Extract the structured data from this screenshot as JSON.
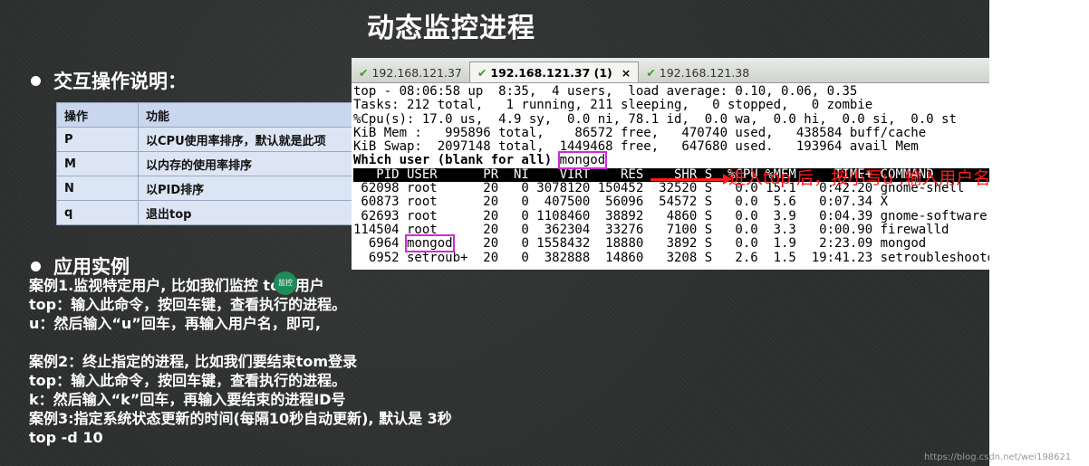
{
  "slide_title": "动态监控进程",
  "section1_title": "交互操作说明：",
  "table": {
    "headers": [
      "操作",
      "功能"
    ],
    "rows": [
      [
        "P",
        "以CPU使用率排序，默认就是此项"
      ],
      [
        "M",
        "以内存的使用率排序"
      ],
      [
        "N",
        "以PID排序"
      ],
      [
        "q",
        "退出top"
      ]
    ]
  },
  "section2_title": "应用实例",
  "cases": [
    "案例1.监视特定用户, 比如我们监控 tom用户",
    "top：输入此命令，按回车键，查看执行的进程。",
    "u：然后输入“u”回车，再输入用户名，即可,",
    "",
    "案例2：终止指定的进程, 比如我们要结束tom登录",
    "top：输入此命令，按回车键，查看执行的进程。",
    "k：然后输入“k”回车，再输入要结束的进程ID号",
    "案例3:指定系统状态更新的时间(每隔10秒自动更新), 默认是 3秒",
    "top -d 10"
  ],
  "green_dot_label": "监控",
  "terminal": {
    "tabs": [
      {
        "label": "192.168.121.37",
        "active": false
      },
      {
        "label": "192.168.121.37 (1)",
        "active": true
      },
      {
        "label": "192.168.121.38",
        "active": false
      }
    ],
    "close_label": "×",
    "lines": [
      "top - 08:06:58 up  8:35,  4 users,  load average: 0.10, 0.06, 0.35",
      "Tasks: 212 total,   1 running, 211 sleeping,   0 stopped,   0 zombie",
      "%Cpu(s): 17.0 us,  4.9 sy,  0.0 ni, 78.1 id,  0.0 wa,  0.0 hi,  0.0 si,  0.0 st",
      "KiB Mem :   995896 total,    86572 free,   470740 used,   438584 buff/cache",
      "KiB Swap:  2097148 total,  1449468 free,   647680 used.   193964 avail Mem"
    ],
    "prompt": "Which user (blank for all) ",
    "prompt_value": "mongod",
    "process_header": "   PID USER      PR  NI    VIRT    RES    SHR S  %CPU %MEM     TIME+ COMMAND",
    "processes": [
      " 62098 root      20   0 3078120 150452  32520 S   0.0 15.1   0:42.20 gnome-shell",
      " 60873 root      20   0  407500  56096  54572 S   0.0  5.6   0:07.34 X",
      " 62693 root      20   0 1108460  38892   4860 S   0.0  3.9   0:04.39 gnome-software",
      "114504 root      20   0  362304  33276   7100 S   0.0  3.3   0:00.90 firewalld",
      "  6964 ",
      "  6952 setroub+  20   0  382888  14860   3208 S   2.6  1.5  19:41.23 setroubleshootd"
    ],
    "mongod_user": "mongod",
    "mongod_rest": "    20   0 1558432  18880   3892 S   0.0  1.9   2:23.09 mongod"
  },
  "annotation": "进入top 后，按小写u ,输入用户名",
  "watermark": "https://blog.csdn.net/wei198621",
  "colors": {
    "highlight": "#d12ad6",
    "annotation": "#ff1a1a",
    "table_bg": "#dce5f3"
  }
}
